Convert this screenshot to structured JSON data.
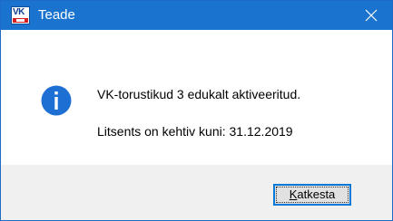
{
  "window": {
    "title": "Teade",
    "app_icon": "vk-app-icon",
    "close_icon": "close-icon",
    "accent_color": "#1a74cf"
  },
  "message": {
    "icon": "info-icon",
    "line1": "VK-torustikud 3 edukalt aktiveeritud.",
    "line2": "Litsents on kehtiv kuni: 31.12.2019"
  },
  "buttons": {
    "cancel_label_mnemonic": "K",
    "cancel_label_rest": "atkesta",
    "cancel_label": "Katkesta"
  }
}
